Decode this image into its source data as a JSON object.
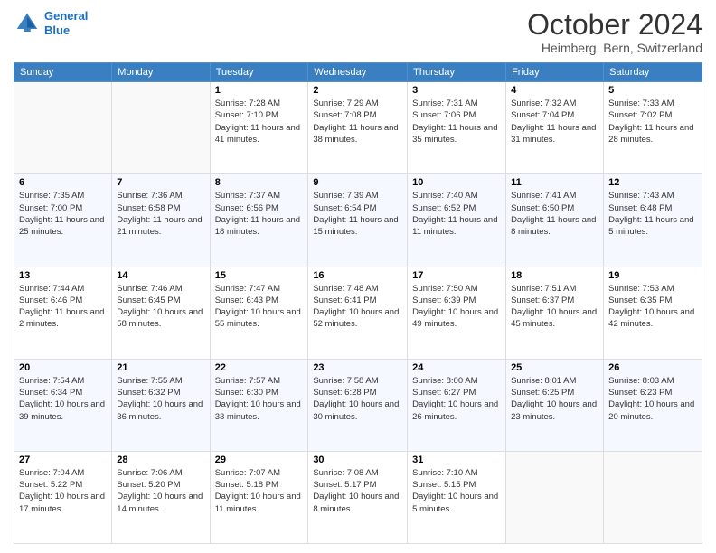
{
  "header": {
    "logo_line1": "General",
    "logo_line2": "Blue",
    "month": "October 2024",
    "location": "Heimberg, Bern, Switzerland"
  },
  "weekdays": [
    "Sunday",
    "Monday",
    "Tuesday",
    "Wednesday",
    "Thursday",
    "Friday",
    "Saturday"
  ],
  "weeks": [
    [
      {
        "day": "",
        "sunrise": "",
        "sunset": "",
        "daylight": ""
      },
      {
        "day": "",
        "sunrise": "",
        "sunset": "",
        "daylight": ""
      },
      {
        "day": "1",
        "sunrise": "Sunrise: 7:28 AM",
        "sunset": "Sunset: 7:10 PM",
        "daylight": "Daylight: 11 hours and 41 minutes."
      },
      {
        "day": "2",
        "sunrise": "Sunrise: 7:29 AM",
        "sunset": "Sunset: 7:08 PM",
        "daylight": "Daylight: 11 hours and 38 minutes."
      },
      {
        "day": "3",
        "sunrise": "Sunrise: 7:31 AM",
        "sunset": "Sunset: 7:06 PM",
        "daylight": "Daylight: 11 hours and 35 minutes."
      },
      {
        "day": "4",
        "sunrise": "Sunrise: 7:32 AM",
        "sunset": "Sunset: 7:04 PM",
        "daylight": "Daylight: 11 hours and 31 minutes."
      },
      {
        "day": "5",
        "sunrise": "Sunrise: 7:33 AM",
        "sunset": "Sunset: 7:02 PM",
        "daylight": "Daylight: 11 hours and 28 minutes."
      }
    ],
    [
      {
        "day": "6",
        "sunrise": "Sunrise: 7:35 AM",
        "sunset": "Sunset: 7:00 PM",
        "daylight": "Daylight: 11 hours and 25 minutes."
      },
      {
        "day": "7",
        "sunrise": "Sunrise: 7:36 AM",
        "sunset": "Sunset: 6:58 PM",
        "daylight": "Daylight: 11 hours and 21 minutes."
      },
      {
        "day": "8",
        "sunrise": "Sunrise: 7:37 AM",
        "sunset": "Sunset: 6:56 PM",
        "daylight": "Daylight: 11 hours and 18 minutes."
      },
      {
        "day": "9",
        "sunrise": "Sunrise: 7:39 AM",
        "sunset": "Sunset: 6:54 PM",
        "daylight": "Daylight: 11 hours and 15 minutes."
      },
      {
        "day": "10",
        "sunrise": "Sunrise: 7:40 AM",
        "sunset": "Sunset: 6:52 PM",
        "daylight": "Daylight: 11 hours and 11 minutes."
      },
      {
        "day": "11",
        "sunrise": "Sunrise: 7:41 AM",
        "sunset": "Sunset: 6:50 PM",
        "daylight": "Daylight: 11 hours and 8 minutes."
      },
      {
        "day": "12",
        "sunrise": "Sunrise: 7:43 AM",
        "sunset": "Sunset: 6:48 PM",
        "daylight": "Daylight: 11 hours and 5 minutes."
      }
    ],
    [
      {
        "day": "13",
        "sunrise": "Sunrise: 7:44 AM",
        "sunset": "Sunset: 6:46 PM",
        "daylight": "Daylight: 11 hours and 2 minutes."
      },
      {
        "day": "14",
        "sunrise": "Sunrise: 7:46 AM",
        "sunset": "Sunset: 6:45 PM",
        "daylight": "Daylight: 10 hours and 58 minutes."
      },
      {
        "day": "15",
        "sunrise": "Sunrise: 7:47 AM",
        "sunset": "Sunset: 6:43 PM",
        "daylight": "Daylight: 10 hours and 55 minutes."
      },
      {
        "day": "16",
        "sunrise": "Sunrise: 7:48 AM",
        "sunset": "Sunset: 6:41 PM",
        "daylight": "Daylight: 10 hours and 52 minutes."
      },
      {
        "day": "17",
        "sunrise": "Sunrise: 7:50 AM",
        "sunset": "Sunset: 6:39 PM",
        "daylight": "Daylight: 10 hours and 49 minutes."
      },
      {
        "day": "18",
        "sunrise": "Sunrise: 7:51 AM",
        "sunset": "Sunset: 6:37 PM",
        "daylight": "Daylight: 10 hours and 45 minutes."
      },
      {
        "day": "19",
        "sunrise": "Sunrise: 7:53 AM",
        "sunset": "Sunset: 6:35 PM",
        "daylight": "Daylight: 10 hours and 42 minutes."
      }
    ],
    [
      {
        "day": "20",
        "sunrise": "Sunrise: 7:54 AM",
        "sunset": "Sunset: 6:34 PM",
        "daylight": "Daylight: 10 hours and 39 minutes."
      },
      {
        "day": "21",
        "sunrise": "Sunrise: 7:55 AM",
        "sunset": "Sunset: 6:32 PM",
        "daylight": "Daylight: 10 hours and 36 minutes."
      },
      {
        "day": "22",
        "sunrise": "Sunrise: 7:57 AM",
        "sunset": "Sunset: 6:30 PM",
        "daylight": "Daylight: 10 hours and 33 minutes."
      },
      {
        "day": "23",
        "sunrise": "Sunrise: 7:58 AM",
        "sunset": "Sunset: 6:28 PM",
        "daylight": "Daylight: 10 hours and 30 minutes."
      },
      {
        "day": "24",
        "sunrise": "Sunrise: 8:00 AM",
        "sunset": "Sunset: 6:27 PM",
        "daylight": "Daylight: 10 hours and 26 minutes."
      },
      {
        "day": "25",
        "sunrise": "Sunrise: 8:01 AM",
        "sunset": "Sunset: 6:25 PM",
        "daylight": "Daylight: 10 hours and 23 minutes."
      },
      {
        "day": "26",
        "sunrise": "Sunrise: 8:03 AM",
        "sunset": "Sunset: 6:23 PM",
        "daylight": "Daylight: 10 hours and 20 minutes."
      }
    ],
    [
      {
        "day": "27",
        "sunrise": "Sunrise: 7:04 AM",
        "sunset": "Sunset: 5:22 PM",
        "daylight": "Daylight: 10 hours and 17 minutes."
      },
      {
        "day": "28",
        "sunrise": "Sunrise: 7:06 AM",
        "sunset": "Sunset: 5:20 PM",
        "daylight": "Daylight: 10 hours and 14 minutes."
      },
      {
        "day": "29",
        "sunrise": "Sunrise: 7:07 AM",
        "sunset": "Sunset: 5:18 PM",
        "daylight": "Daylight: 10 hours and 11 minutes."
      },
      {
        "day": "30",
        "sunrise": "Sunrise: 7:08 AM",
        "sunset": "Sunset: 5:17 PM",
        "daylight": "Daylight: 10 hours and 8 minutes."
      },
      {
        "day": "31",
        "sunrise": "Sunrise: 7:10 AM",
        "sunset": "Sunset: 5:15 PM",
        "daylight": "Daylight: 10 hours and 5 minutes."
      },
      {
        "day": "",
        "sunrise": "",
        "sunset": "",
        "daylight": ""
      },
      {
        "day": "",
        "sunrise": "",
        "sunset": "",
        "daylight": ""
      }
    ]
  ]
}
